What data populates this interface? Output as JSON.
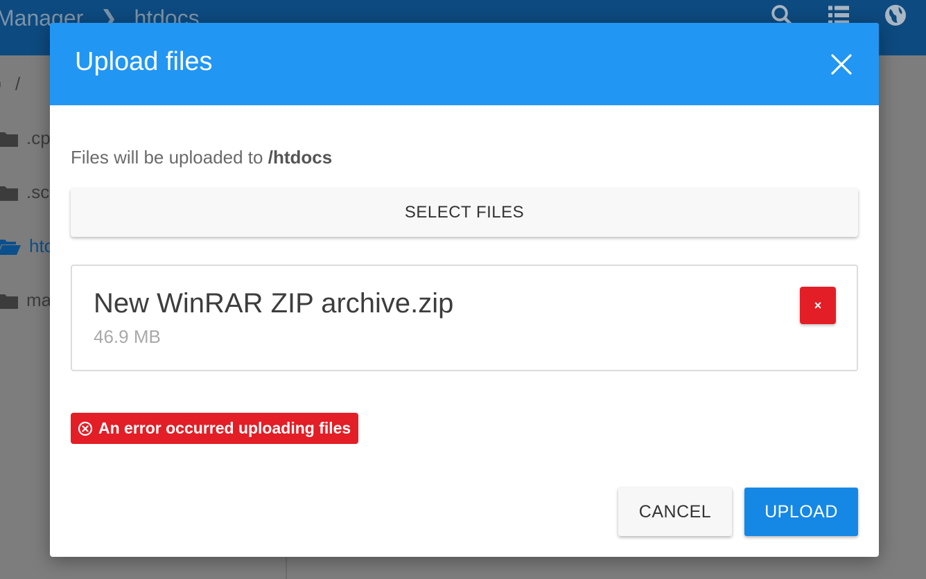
{
  "app": {
    "breadcrumb": [
      "Manager",
      "htdocs"
    ],
    "top_icons": [
      "search-icon",
      "list-view-icon",
      "globe-icon"
    ],
    "tree": [
      {
        "label": "/",
        "icon": "folder-open-icon"
      },
      {
        "label": ".cp",
        "icon": "folder-icon"
      },
      {
        "label": ".sc",
        "icon": "folder-icon"
      },
      {
        "label": "htc",
        "icon": "folder-open-icon",
        "active": true
      },
      {
        "label": "ma",
        "icon": "folder-icon"
      }
    ]
  },
  "modal": {
    "title": "Upload files",
    "destination_prefix": "Files will be uploaded to ",
    "destination_path": "/htdocs",
    "select_label": "SELECT FILES",
    "files": [
      {
        "name": "New WinRAR ZIP archive.zip",
        "size": "46.9 MB",
        "remove_label": "×"
      }
    ],
    "error_message": "An error occurred uploading files",
    "cancel_label": "CANCEL",
    "upload_label": "UPLOAD"
  },
  "colors": {
    "header": "#2196f3",
    "topbar": "#0d4a7f",
    "danger": "#e31e26",
    "primary": "#1588e6"
  }
}
